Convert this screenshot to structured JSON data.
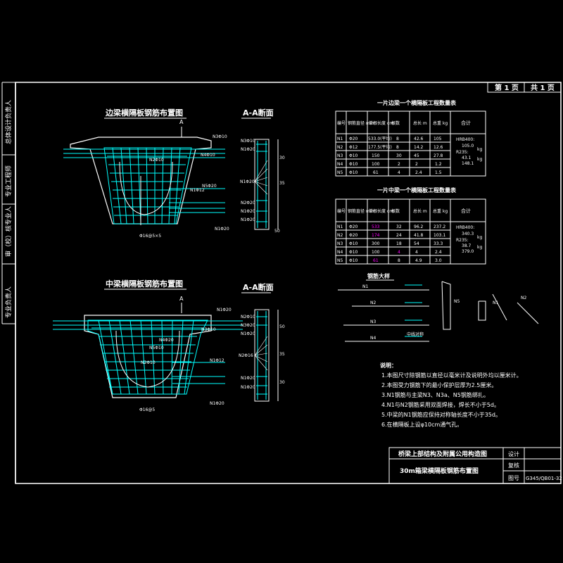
{
  "sheet": {
    "page_label": "第 1 页",
    "total_label": "共 1 页"
  },
  "left_strip": [
    {
      "label": "总体设计负责人"
    },
    {
      "label": "专业工程师"
    },
    {
      "label": "审（校）核专业人"
    },
    {
      "label": "专业负责人"
    }
  ],
  "edge_beam": {
    "title": "边梁横隔板钢筋布置图",
    "section_mark": "A",
    "labels": [
      "N3Φ10",
      "N4Φ10",
      "N2Φ10",
      "N5Φ20",
      "N1Φ12",
      "N1Φ20",
      "Φ16@5×5"
    ]
  },
  "edge_section": {
    "title": "A-A断面",
    "left_labels": [
      "N3Φ10",
      "N1Φ20",
      "N1Φ20",
      "N2Φ20",
      "N1Φ20",
      "N1Φ20"
    ],
    "dims": [
      "30",
      "35",
      "50"
    ]
  },
  "mid_beam": {
    "title": "中梁横隔板钢筋布置图",
    "section_mark": "A",
    "labels": [
      "N1Φ20",
      "N3Φ10",
      "N4Φ20",
      "N5Φ10",
      "N2Φ10",
      "N1Φ12",
      "N1Φ20",
      "Φ16@5"
    ]
  },
  "mid_section": {
    "title": "A-A断面",
    "left_labels": [
      "N2Φ10",
      "N3Φ20",
      "N1Φ20",
      "N2Φ16",
      "N1Φ20",
      "N1Φ20"
    ],
    "dims": [
      "50",
      "35",
      "30"
    ]
  },
  "table1": {
    "title": "一片边梁一个横隔板工程数量表",
    "headers": [
      "编号",
      "钢筋直径 mm",
      "单根长度 cm",
      "根数",
      "总长 m",
      "总重 kg",
      "合计"
    ],
    "rows": [
      [
        "N1",
        "Φ20",
        "533.0(平均)",
        "8",
        "42.6",
        "105"
      ],
      [
        "N2",
        "Φ12",
        "177.5(平均)",
        "8",
        "14.2",
        "12.6"
      ],
      [
        "N3",
        "Φ10",
        "150",
        "30",
        "45",
        "27.8"
      ],
      [
        "N4",
        "Φ10",
        "100",
        "2",
        "2",
        "1.2"
      ],
      [
        "N5",
        "Φ10",
        "61",
        "4",
        "2.4",
        "1.5"
      ]
    ],
    "total_lines": [
      "HRB400:",
      "105.0",
      "R235:",
      "43.1",
      "kg",
      "148.1",
      "kg"
    ]
  },
  "table2": {
    "title": "一片中梁一个横隔板工程数量表",
    "headers": [
      "编号",
      "钢筋直径 mm",
      "单根长度 cm",
      "根数",
      "总长 m",
      "总重 kg",
      "合计"
    ],
    "rows": [
      [
        "N1",
        "Φ20",
        "533",
        "32",
        "96.2",
        "237.2"
      ],
      [
        "N2",
        "Φ20",
        "174",
        "24",
        "41.8",
        "103.1"
      ],
      [
        "N3",
        "Φ10",
        "300",
        "18",
        "54",
        "33.3"
      ],
      [
        "N4",
        "Φ10",
        "100",
        "4",
        "4",
        "2.4"
      ],
      [
        "N5",
        "Φ10",
        "61",
        "8",
        "4.9",
        "3.0"
      ]
    ],
    "total_lines": [
      "HRB400:",
      "340.3",
      "R235:",
      "38.7",
      "kg",
      "379.0",
      "kg"
    ]
  },
  "detail": {
    "title": "钢筋大样",
    "labels": [
      "N1",
      "N2",
      "N3",
      "N4",
      "N5",
      "中线对称",
      "N1",
      "N2"
    ]
  },
  "notes": {
    "heading": "说明：",
    "items": [
      "1.本图尺寸除钢筋以直径以毫米计及说明外均以厘米计。",
      "2.本图受力钢筋下的最小保护层厚为2.5厘米。",
      "3.N1钢筋与主梁N3、N3a、N5钢筋绑扎。",
      "4.N1与N2钢筋采用双面焊接，焊长不小于5d。",
      "5.中梁的N1钢筋应保持对称轴长度不小于35d。",
      "6.在横隔板上设φ10cm通气孔。"
    ]
  },
  "title_block": {
    "project": "桥梁上部结构及附属公用构造图",
    "drawing": "30m箱梁横隔板钢筋布置图",
    "design_label": "设计",
    "review_label": "复核",
    "number_label": "图号",
    "number_value": "G345/QB01-32"
  },
  "colors": {
    "frame": "#ffffff",
    "rebar": "#00ffff",
    "text": "#ffffff",
    "highlight": "#ff00ff",
    "accent": "#ffff00"
  }
}
